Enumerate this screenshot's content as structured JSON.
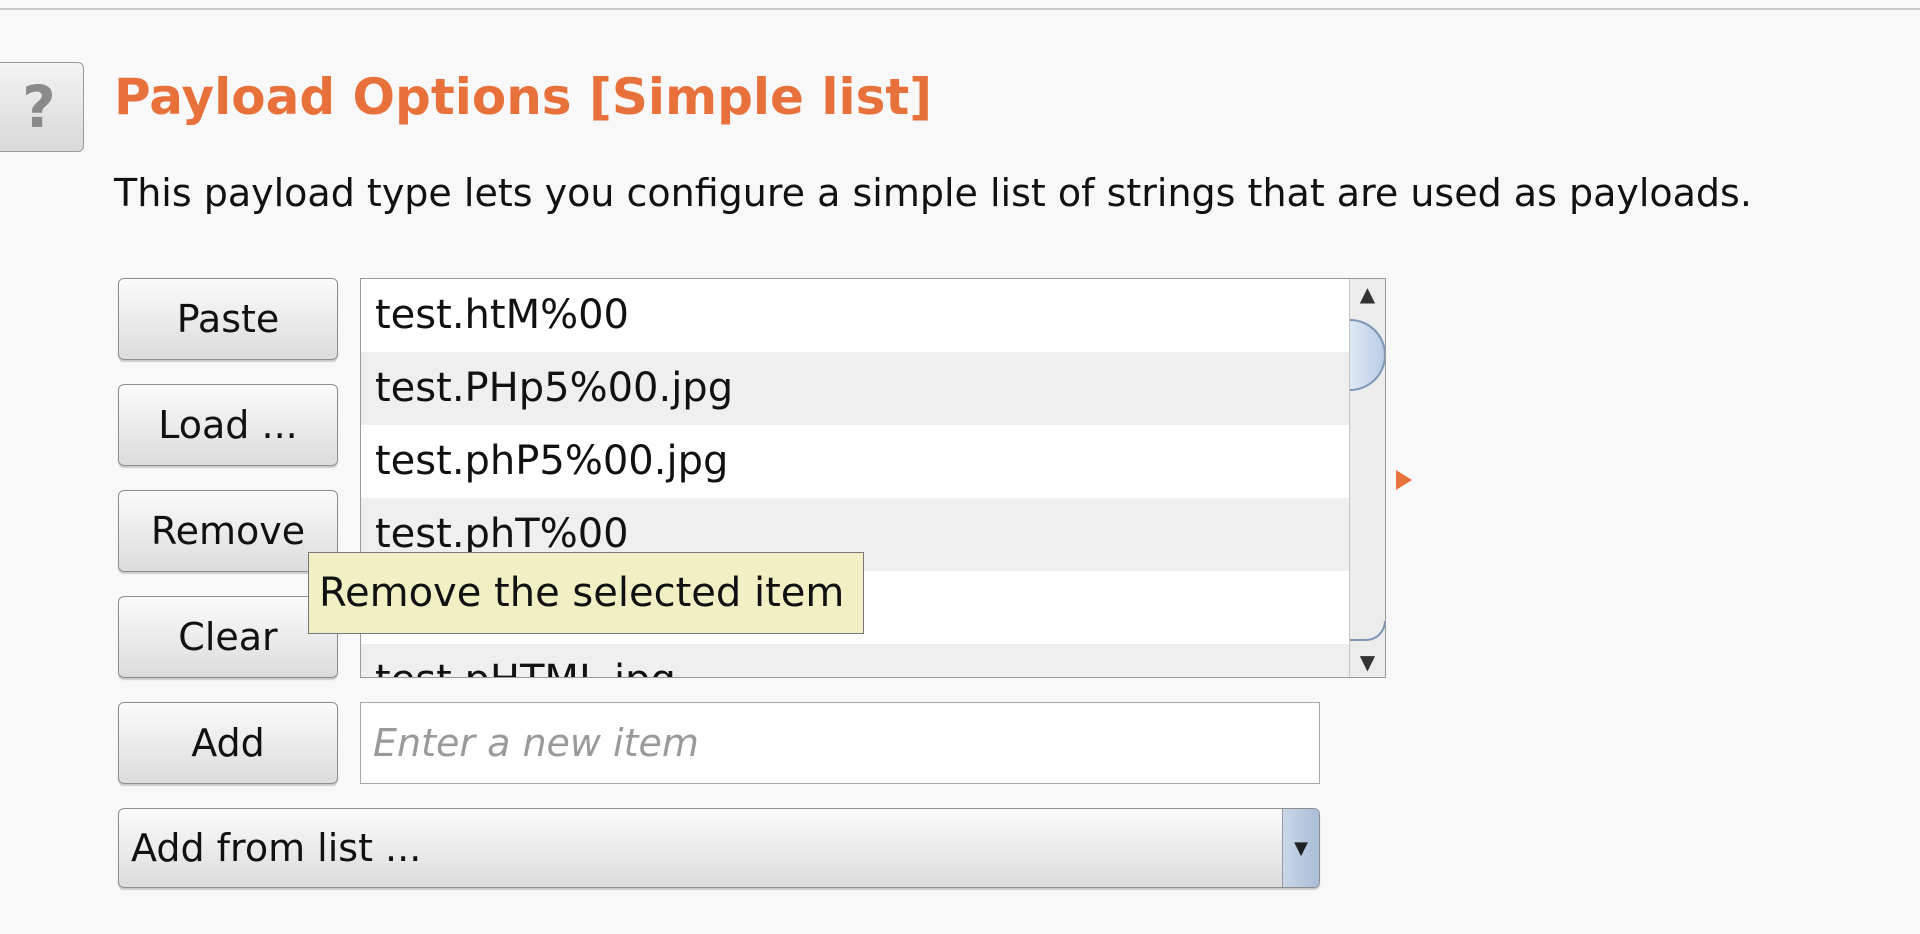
{
  "header": {
    "help_label": "?",
    "title": "Payload Options [Simple list]",
    "description": "This payload type lets you configure a simple list of strings that are used as payloads."
  },
  "buttons": {
    "paste": "Paste",
    "load": "Load ...",
    "remove": "Remove",
    "clear": "Clear",
    "add": "Add"
  },
  "list": {
    "items": [
      "test.htM%00",
      "test.PHp5%00.jpg",
      "test.phP5%00.jpg",
      "test.phT%00",
      "",
      "test.pHTML.jpg"
    ]
  },
  "tooltip": {
    "text": "Remove the selected item"
  },
  "add_input": {
    "value": "",
    "placeholder": "Enter a new item"
  },
  "add_from_list": {
    "label": "Add from list ..."
  },
  "colors": {
    "accent": "#e8703a",
    "tooltip_bg": "#f1f0c4"
  }
}
